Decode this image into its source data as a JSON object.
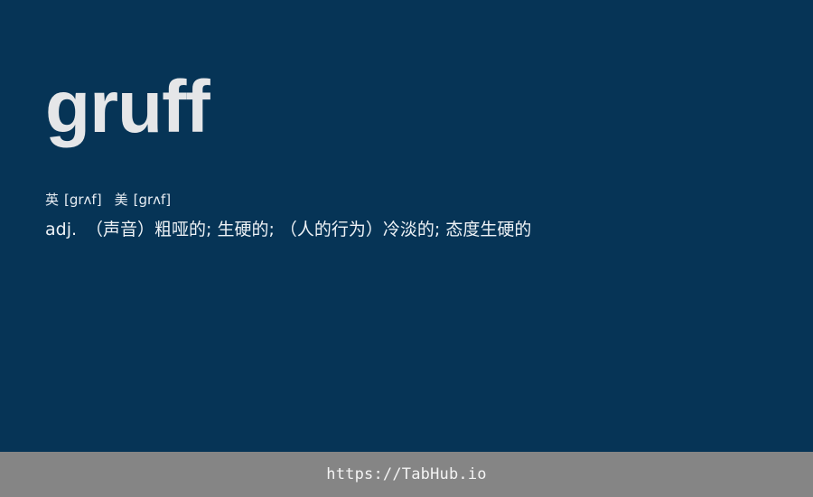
{
  "entry": {
    "word": "gruff",
    "phonetics": {
      "uk_label": "英",
      "uk_ipa": "[grʌf]",
      "us_label": "美",
      "us_ipa": "[grʌf]"
    },
    "definition": {
      "pos": "adj.",
      "text": "（声音）粗哑的; 生硬的; （人的行为）冷淡的; 态度生硬的"
    }
  },
  "footer": {
    "url": "https://TabHub.io"
  },
  "colors": {
    "background": "#063456",
    "footer_background": "#858585",
    "text": "#e5e6e8"
  }
}
